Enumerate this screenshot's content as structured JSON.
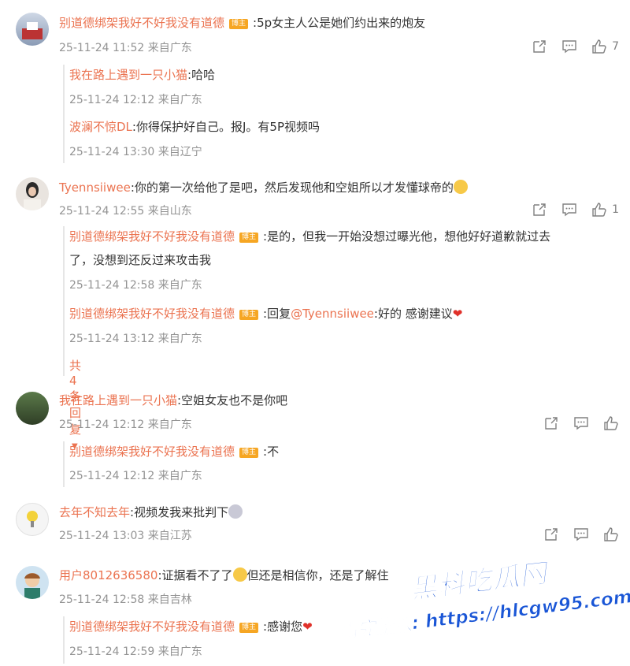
{
  "comments": [
    {
      "user": "别道德绑架我好不好我没有道德",
      "badge": "博主",
      "text": ":5p女主人公是她们约出来的炮友",
      "meta": "25-11-24 11:52 来自广东",
      "likes": "7",
      "replies": [
        {
          "user": "我在路上遇到一只小猫",
          "text": ":哈哈",
          "meta": "25-11-24 12:12 来自广东"
        },
        {
          "user": "波澜不惊DL",
          "text": ":你得保护好自己。报J。有5P视频吗",
          "meta": "25-11-24 13:30 来自辽宁"
        }
      ]
    },
    {
      "user": "Tyennsiiwee",
      "text": ":你的第一次给他了是吧，然后发现他和空姐所以才发懂球帝的",
      "meta": "25-11-24 12:55 来自山东",
      "likes": "1",
      "replies": [
        {
          "user": "别道德绑架我好不好我没有道德",
          "badge": "博主",
          "text": ":是的，但我一开始没想过曝光他，想他好好道歉就过去",
          "text2": "了，没想到还反过来攻击我",
          "meta": "25-11-24 12:58 来自广东"
        },
        {
          "user": "别道德绑架我好不好我没有道德",
          "badge": "博主",
          "text_pre": ":回复",
          "mention": "@Tyennsiiwee",
          "text": ":好的 感谢建议",
          "meta": "25-11-24 13:12 来自广东"
        }
      ],
      "more": "共4条回复"
    },
    {
      "user": "我在路上遇到一只小猫",
      "text": ":空姐女友也不是你吧",
      "meta": "25-11-24 12:12 来自广东",
      "replies": [
        {
          "user": "别道德绑架我好不好我没有道德",
          "badge": "博主",
          "text": ":不",
          "meta": "25-11-24 12:12 来自广东"
        }
      ]
    },
    {
      "user": "去年不知去年",
      "text": ":视频发我来批判下",
      "meta": "25-11-24 13:03 来自江苏"
    },
    {
      "user": "用户8012636580",
      "text": ":证据看不了了",
      "text_b": "但还是相信你，还是了解住",
      "meta": "25-11-24 12:58 来自吉林",
      "replies": [
        {
          "user": "别道德绑架我好不好我没有道德",
          "badge": "博主",
          "text": ":感谢您",
          "meta": "25-11-24 12:59 来自广东"
        }
      ]
    }
  ],
  "watermark": {
    "brand": "黑料吃瓜网",
    "url": "看完整版: https://hlcgw95.com"
  },
  "icons": {
    "share": "share-icon",
    "comment": "comment-icon",
    "like": "thumbs-up-icon"
  },
  "colors": {
    "username": "#eb7350",
    "meta": "#939393",
    "badge": "#f6a623",
    "watermark": "#1a56d6"
  }
}
